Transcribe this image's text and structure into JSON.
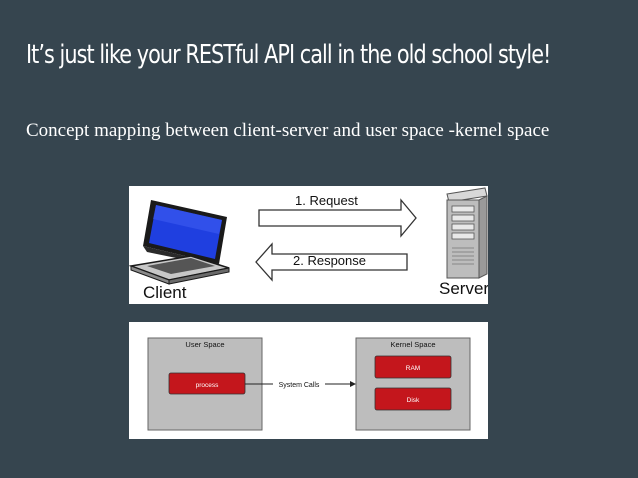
{
  "slide": {
    "title": "It’s just like your RESTful API call in the old school style!",
    "body": "Concept mapping between client-server and user space -kernel space"
  },
  "client_server_diagram": {
    "request_label": "1. Request",
    "response_label": "2. Response",
    "client_label": "Client",
    "server_label": "Server"
  },
  "kernel_diagram": {
    "user_space_label": "User Space",
    "kernel_space_label": "Kernel Space",
    "process_label": "process",
    "system_calls_label": "System Calls",
    "ram_label": "RAM",
    "disk_label": "Disk"
  },
  "colors": {
    "background": "#36454f",
    "box_gray": "#bdbdbd",
    "module_red": "#c4161c"
  }
}
